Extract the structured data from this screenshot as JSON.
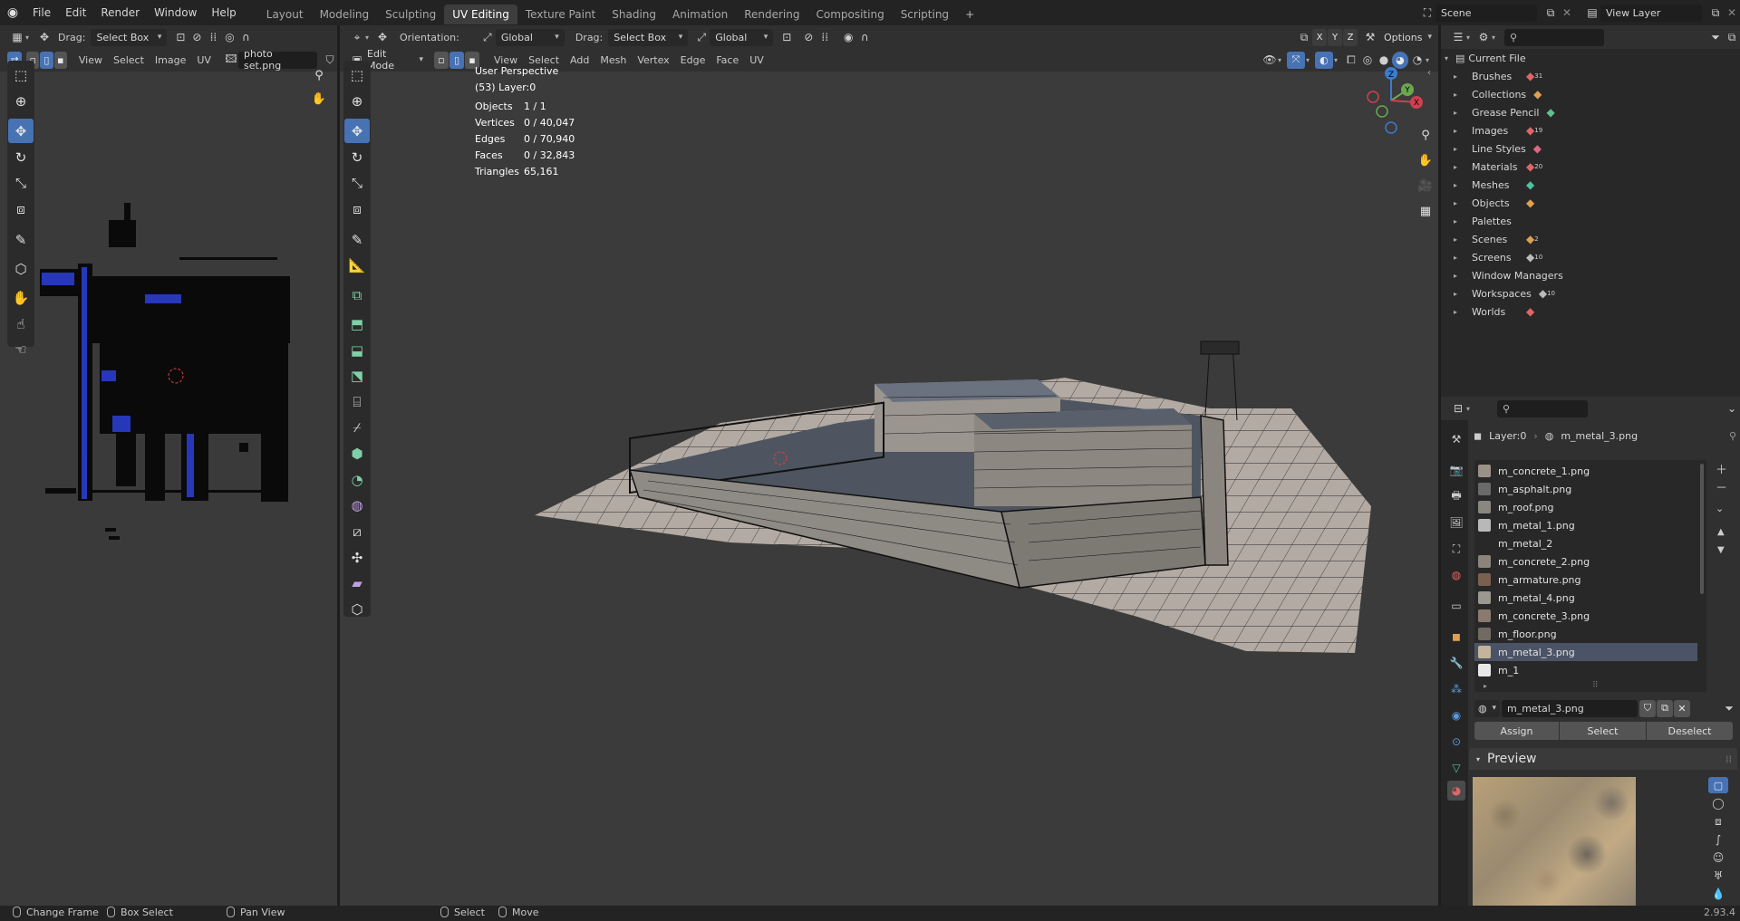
{
  "menu": [
    "File",
    "Edit",
    "Render",
    "Window",
    "Help"
  ],
  "workspaces": [
    "Layout",
    "Modeling",
    "Sculpting",
    "UV Editing",
    "Texture Paint",
    "Shading",
    "Animation",
    "Rendering",
    "Compositing",
    "Scripting"
  ],
  "active_workspace": "UV Editing",
  "scene": "Scene",
  "view_layer": "View Layer",
  "uv_editor": {
    "drag_label": "Drag:",
    "drag_value": "Select Box",
    "menus": [
      "View",
      "Select",
      "Image",
      "UV"
    ],
    "image_name": "photo set.png"
  },
  "viewport": {
    "orientation_label": "Orientation:",
    "orientation_value": "Global",
    "drag_label": "Drag:",
    "drag_value": "Select Box",
    "pivot_value": "Global",
    "options_label": "Options",
    "axis_x": "X",
    "axis_y": "Y",
    "axis_z": "Z",
    "mode": "Edit Mode",
    "menus": [
      "View",
      "Select",
      "Add",
      "Mesh",
      "Vertex",
      "Edge",
      "Face",
      "UV"
    ],
    "perspective": "User Perspective",
    "layer_info": "(53) Layer:0",
    "stats": [
      {
        "key": "Objects",
        "value": "1 / 1"
      },
      {
        "key": "Vertices",
        "value": "0 / 40,047"
      },
      {
        "key": "Edges",
        "value": "0 / 70,940"
      },
      {
        "key": "Faces",
        "value": "0 / 32,843"
      },
      {
        "key": "Triangles",
        "value": "65,161"
      }
    ],
    "gizmo": {
      "z": "Z",
      "y": "Y",
      "x": "X"
    }
  },
  "outliner": {
    "root": "Current File",
    "items": [
      {
        "label": "Brushes",
        "count": "31",
        "color": "#e06666"
      },
      {
        "label": "Collections",
        "count": "",
        "color": "#e0a050"
      },
      {
        "label": "Grease Pencil",
        "count": "",
        "color": "#5fbf8f"
      },
      {
        "label": "Images",
        "count": "19",
        "color": "#e06666"
      },
      {
        "label": "Line Styles",
        "count": "",
        "color": "#e06680"
      },
      {
        "label": "Materials",
        "count": "20",
        "color": "#e06666"
      },
      {
        "label": "Meshes",
        "count": "",
        "color": "#50c0a0"
      },
      {
        "label": "Objects",
        "count": "",
        "color": "#e0a050"
      },
      {
        "label": "Palettes",
        "count": "",
        "color": ""
      },
      {
        "label": "Scenes",
        "count": "2",
        "color": "#e0a050"
      },
      {
        "label": "Screens",
        "count": "10",
        "color": "#bbbbbb"
      },
      {
        "label": "Window Managers",
        "count": "",
        "color": ""
      },
      {
        "label": "Workspaces",
        "count": "10",
        "color": "#bbbbbb"
      },
      {
        "label": "Worlds",
        "count": "",
        "color": "#e06666"
      }
    ]
  },
  "properties": {
    "object": "Layer:0",
    "material": "m_metal_3.png",
    "material_slots": [
      {
        "name": "m_concrete_1.png",
        "color": "#9a9288"
      },
      {
        "name": "m_asphalt.png",
        "color": "#6a6a6a"
      },
      {
        "name": "m_roof.png",
        "color": "#8a8680"
      },
      {
        "name": "m_metal_1.png",
        "color": "#b8b8b8"
      },
      {
        "name": "m_metal_2",
        "color": ""
      },
      {
        "name": "m_concrete_2.png",
        "color": "#8a847a"
      },
      {
        "name": "m_armature.png",
        "color": "#7a6050"
      },
      {
        "name": "m_metal_4.png",
        "color": "#9a9890"
      },
      {
        "name": "m_concrete_3.png",
        "color": "#8a7a70"
      },
      {
        "name": "m_floor.png",
        "color": "#706a62"
      },
      {
        "name": "m_metal_3.png",
        "color": "#c4b49a"
      },
      {
        "name": "m_1",
        "color": "#e8e8e8"
      }
    ],
    "selected_slot": "m_metal_3.png",
    "assign": "Assign",
    "select": "Select",
    "deselect": "Deselect",
    "preview_label": "Preview"
  },
  "status": {
    "change_frame": "Change Frame",
    "box_select": "Box Select",
    "pan_view": "Pan View",
    "select": "Select",
    "move": "Move",
    "version": "2.93.4"
  }
}
